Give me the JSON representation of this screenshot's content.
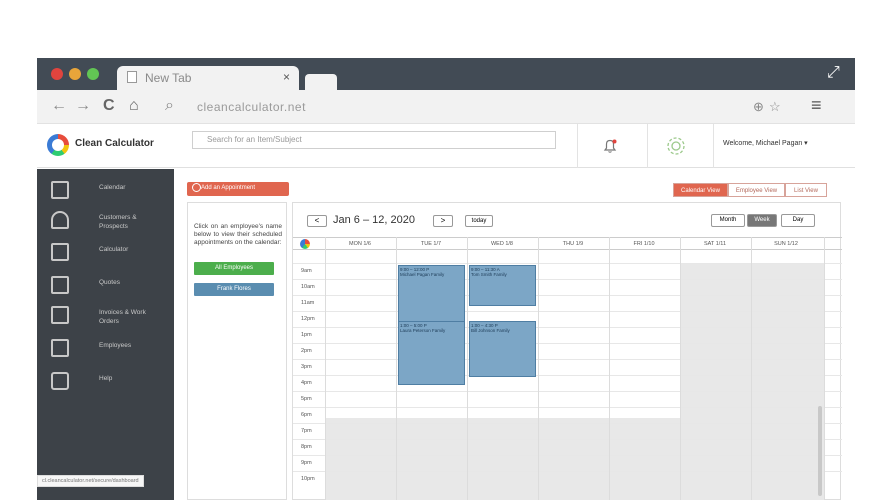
{
  "browser": {
    "tab_title": "New Tab",
    "tab_close": "×",
    "url": "cleancalculator.net",
    "nav": {
      "back": "←",
      "forward": "→",
      "reload": "C",
      "home": "⌂",
      "search": "⌕",
      "zoom": "⊕",
      "star": "☆",
      "menu": "≡"
    },
    "expand_icon": "⤢",
    "status_url": "cl.cleancalculator.net/secure/dashboard"
  },
  "app": {
    "brand": "Clean Calculator",
    "search_placeholder": "Search for an Item/Subject",
    "welcome": "Welcome, Michael Pagan ▾"
  },
  "sidebar": {
    "items": [
      {
        "label": "Calendar",
        "icon": "calendar-icon"
      },
      {
        "label": "Customers & Prospects",
        "icon": "users-icon"
      },
      {
        "label": "Calculator",
        "icon": "calculator-icon"
      },
      {
        "label": "Quotes",
        "icon": "quotes-icon"
      },
      {
        "label": "Invoices & Work Orders",
        "icon": "invoice-icon"
      },
      {
        "label": "Employees",
        "icon": "employee-icon"
      },
      {
        "label": "Help",
        "icon": "help-icon"
      }
    ]
  },
  "toolbar": {
    "add_appointment": "Add an Appointment",
    "views": [
      "Calendar View",
      "Employee View",
      "List View"
    ],
    "active_view": "Calendar View"
  },
  "left_panel": {
    "instructions": "Click on an employee's name below to view their scheduled appointments on the calendar:",
    "all_employees": "All Employees",
    "employee": "Frank Flores"
  },
  "calendar": {
    "prev": "<",
    "next": ">",
    "range": "Jan 6 – 12, 2020",
    "today": "today",
    "modes": [
      "Month",
      "Week",
      "Day"
    ],
    "active_mode": "Week",
    "days": [
      "MON 1/6",
      "TUE 1/7",
      "WED 1/8",
      "THU 1/9",
      "FRI 1/10",
      "SAT 1/11",
      "SUN 1/12"
    ],
    "hours": [
      "9am",
      "10am",
      "11am",
      "12pm",
      "1pm",
      "2pm",
      "3pm",
      "4pm",
      "5pm",
      "6pm",
      "7pm",
      "8pm",
      "9pm",
      "10pm"
    ],
    "events": [
      {
        "day": "TUE 1/7",
        "time": "9:00 – 12:00 P",
        "title": "Michael Pagan Family"
      },
      {
        "day": "WED 1/8",
        "time": "9:00 – 11:30 A",
        "title": "Tom Smith Family"
      },
      {
        "day": "TUE 1/7",
        "time": "1:00 – 5:00 P",
        "title": "Laura Peterson Family"
      },
      {
        "day": "WED 1/8",
        "time": "1:00 – 4:30 P",
        "title": "Bill Johnson Family"
      }
    ]
  },
  "colors": {
    "chrome": "#424b55",
    "sidebar": "#3d4248",
    "accent": "#e0664f",
    "green": "#4cae4c",
    "event": "#7ca6c6"
  }
}
